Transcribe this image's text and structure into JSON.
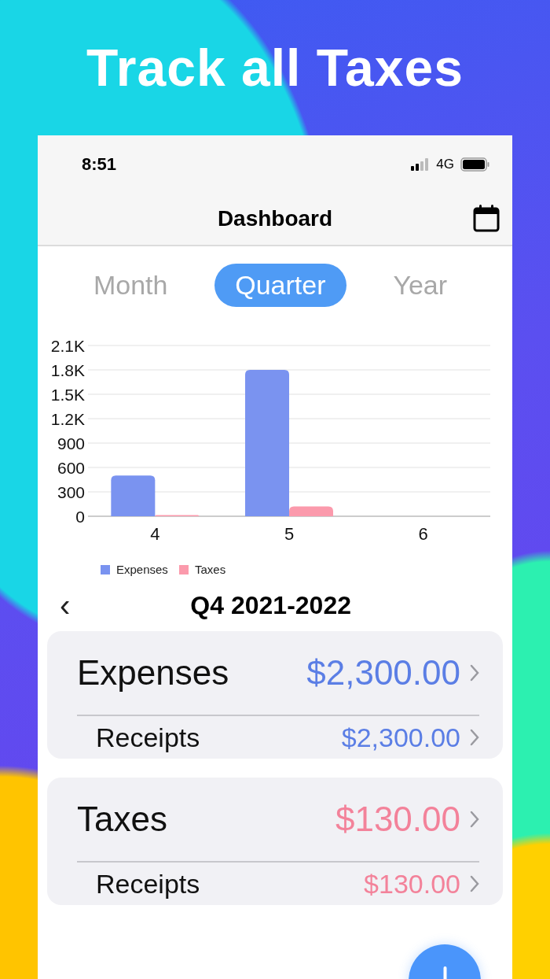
{
  "headline": "Track all Taxes",
  "status_bar": {
    "time": "8:51",
    "network": "4G"
  },
  "nav": {
    "title": "Dashboard"
  },
  "segments": [
    {
      "label": "Month",
      "selected": false
    },
    {
      "label": "Quarter",
      "selected": true
    },
    {
      "label": "Year",
      "selected": false
    }
  ],
  "chart": {
    "chart_data": {
      "type": "bar",
      "grid": true,
      "legend": true,
      "categories": [
        "4",
        "5",
        "6"
      ],
      "series": [
        {
          "name": "Expenses",
          "color": "#7a93f0",
          "values": [
            500,
            1800,
            0
          ]
        },
        {
          "name": "Taxes",
          "color": "#fb9aac",
          "values": [
            10,
            120,
            0
          ]
        }
      ],
      "ylim": [
        0,
        2100
      ],
      "yticks": [
        0,
        300,
        600,
        900,
        {
          "value": 1200,
          "label": "1.2K"
        },
        {
          "value": 1500,
          "label": "1.5K"
        },
        {
          "value": 1800,
          "label": "1.8K"
        },
        {
          "value": 2100,
          "label": "2.1K"
        }
      ]
    }
  },
  "period": {
    "back": "‹",
    "label": "Q4 2021-2022"
  },
  "summary_cards": [
    {
      "title": "Expenses",
      "total": "$2,300.00",
      "color": "#5b7ee5",
      "rows": [
        {
          "label": "Receipts",
          "amount": "$2,300.00"
        }
      ]
    },
    {
      "title": "Taxes",
      "total": "$130.00",
      "color": "#f3829a",
      "rows": [
        {
          "label": "Receipts",
          "amount": "$130.00"
        }
      ]
    }
  ]
}
